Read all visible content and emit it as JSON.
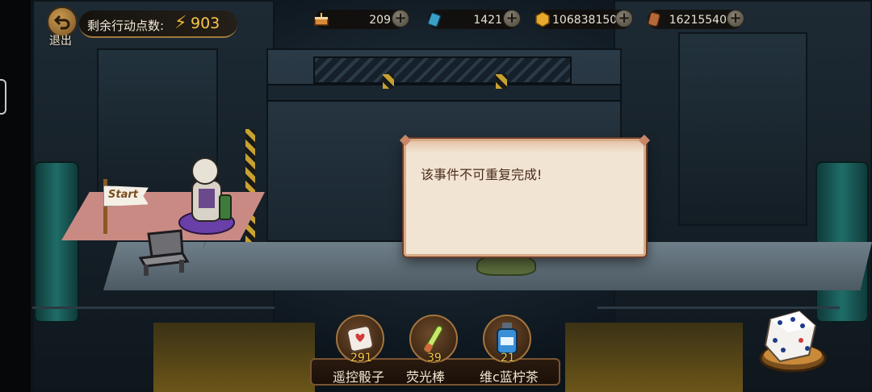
{
  "top": {
    "exit_label": "退出",
    "action_points_label": "剩余行动点数:",
    "action_points_value": "903",
    "resources": [
      {
        "icon": "cake-icon",
        "value": "209"
      },
      {
        "icon": "battery-icon",
        "value": "1421"
      },
      {
        "icon": "gold-coin-icon",
        "value": "106838150"
      },
      {
        "icon": "bronze-coin-icon",
        "value": "16215540"
      }
    ],
    "plus_symbol": "+"
  },
  "board": {
    "start_flag_text": "Start"
  },
  "dialog": {
    "message": "该事件不可重复完成!"
  },
  "items": [
    {
      "name": "遥控骰子",
      "count": "291",
      "icon": "remote-dice-icon"
    },
    {
      "name": "荧光棒",
      "count": "39",
      "icon": "glow-stick-icon"
    },
    {
      "name": "维c蓝柠茶",
      "count": "21",
      "icon": "lemon-tea-bottle-icon"
    }
  ],
  "colors": {
    "accent_gold": "#f7c64b",
    "dialog_bg": "#f2e4d3",
    "dialog_border": "#d8ac86",
    "tile": "#6f7f89",
    "start_tile": "#c98a84"
  }
}
